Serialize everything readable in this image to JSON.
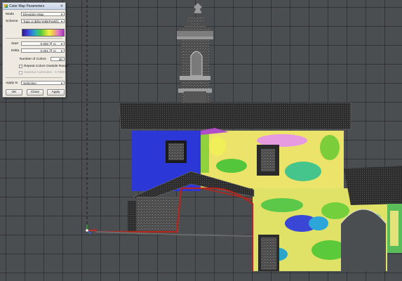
{
  "dialog": {
    "title": "Color Map Parameters",
    "mode_label": "Mode",
    "mode_value": "Elevation Map",
    "scheme_label": "Scheme",
    "scheme_value": "Topo 3 (BlGrYelBrPuWh)",
    "start_label": "Start",
    "start_value": "0.000",
    "start_unit": "m",
    "delta_label": "Delta",
    "delta_value": "0.001",
    "delta_unit": "m",
    "num_colors_label": "Number of Colors",
    "num_colors_value": "30",
    "repeat_label": "Repeat Colors Outside Range",
    "gamma_label": "Gamma Correction",
    "gamma_value": "0.7000",
    "apply_to_label": "Apply to",
    "apply_to_value": "Selection",
    "ok_label": "OK",
    "close_label": "Close",
    "apply_label": "Apply"
  },
  "colors": {
    "viewport_bg": "#4b4e51",
    "accent_blue": "#2e3ad0",
    "boundary_red": "#b3261e"
  }
}
